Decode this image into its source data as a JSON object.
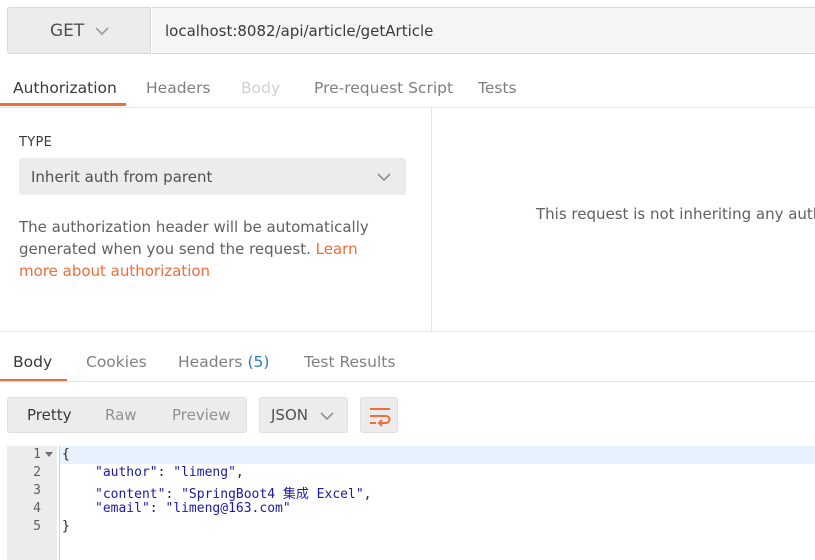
{
  "request": {
    "method": "GET",
    "url": "localhost:8082/api/article/getArticle"
  },
  "request_tabs": [
    {
      "label": "Authorization",
      "state": "active"
    },
    {
      "label": "Headers",
      "state": "normal"
    },
    {
      "label": "Body",
      "state": "disabled"
    },
    {
      "label": "Pre-request Script",
      "state": "normal"
    },
    {
      "label": "Tests",
      "state": "normal"
    }
  ],
  "auth": {
    "type_label": "TYPE",
    "type_value": "Inherit auth from parent",
    "description": "The authorization header will be automatically generated when you send the request.",
    "link_text": "Learn more about authorization",
    "inherit_message": "This request is not inheriting any author"
  },
  "response_tabs": {
    "body": "Body",
    "cookies": "Cookies",
    "headers": "Headers",
    "headers_count": "(5)",
    "test_results": "Test Results"
  },
  "view_modes": {
    "pretty": "Pretty",
    "raw": "Raw",
    "preview": "Preview",
    "format": "JSON"
  },
  "code": {
    "line_numbers": [
      "1",
      "2",
      "3",
      "4",
      "5"
    ],
    "open_brace": "{",
    "close_brace": "}",
    "entries": [
      {
        "key": "\"author\"",
        "value": "\"limeng\"",
        "trail": ","
      },
      {
        "key": "\"content\"",
        "value": "\"SpringBoot4 集成 Excel\"",
        "trail": ","
      },
      {
        "key": "\"email\"",
        "value": "\"limeng@163.com\"",
        "trail": ""
      }
    ]
  },
  "colors": {
    "accent": "#f26b3a",
    "link_blue": "#2a7ac0",
    "json_string": "#1a1aa6"
  },
  "icons": {
    "method_dropdown": "chevron-down-icon",
    "type_dropdown": "chevron-down-icon",
    "format_dropdown": "chevron-down-icon",
    "wrap": "wrap-lines-icon",
    "fold": "fold-caret-icon"
  }
}
